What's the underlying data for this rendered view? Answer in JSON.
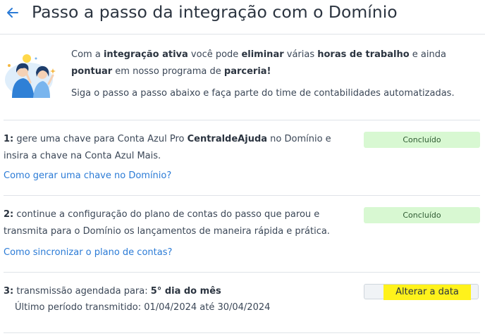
{
  "header": {
    "title": "Passo a passo da integração com o Domínio"
  },
  "intro": {
    "p1_a": "Com a ",
    "p1_b": "integração ativa",
    "p1_c": " você pode ",
    "p1_d": "eliminar",
    "p1_e": " várias ",
    "p1_f": "horas de trabalho",
    "p1_g": " e ainda ",
    "p1_h": "pontuar",
    "p1_i": " em nosso programa de ",
    "p1_j": "parceria!",
    "p2": "Siga o passo a passo abaixo e faça parte do time de contabilidades automatizadas."
  },
  "steps": [
    {
      "num": "1:",
      "text_a": " gere uma chave para Conta Azul Pro ",
      "text_b": "CentraldeAjuda",
      "text_c": " no Domínio e insira a chave na Conta Azul Mais.",
      "link": "Como gerar uma chave no Domínio?",
      "status": "Concluído"
    },
    {
      "num": "2:",
      "text_a": " continue a configuração do plano de contas do passo que parou e transmita para o Domínio os lançamentos de maneira rápida e prática.",
      "link": "Como sincronizar o plano de contas?",
      "status": "Concluído"
    },
    {
      "num": "3:",
      "text_a": " transmissão agendada para: ",
      "text_b": "5° dia do mês",
      "last_period": "Último período transmitido: 01/04/2024 até 30/04/2024",
      "button": "Alterar a data"
    }
  ],
  "colors": {
    "link": "#2b7bd6",
    "success_bg": "#d8f8d2",
    "highlight": "#fff21b",
    "divider": "#dfe3e8"
  },
  "icons": {
    "back": "arrow-left-icon",
    "illustration": "people-celebration-illustration"
  }
}
